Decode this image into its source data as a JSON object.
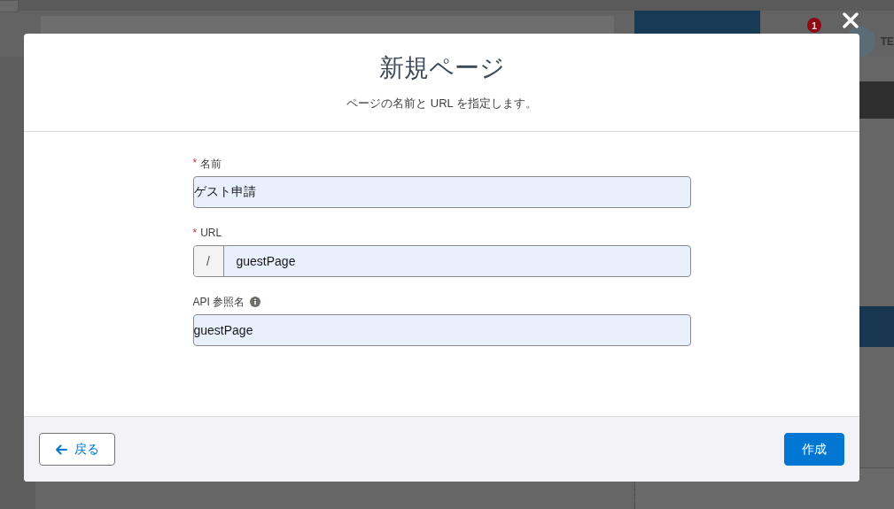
{
  "background": {
    "notification_count": "1",
    "user_name": "TE"
  },
  "modal": {
    "title": "新規ページ",
    "subtitle": "ページの名前と URL を指定します。",
    "fields": [
      {
        "kind": "text",
        "label": "名前",
        "required_mark": "*",
        "info": false,
        "value": "ゲスト申請"
      },
      {
        "kind": "prefixed",
        "label": "URL",
        "required_mark": "*",
        "info": false,
        "prefix": "/",
        "value": "guestPage"
      },
      {
        "kind": "text",
        "label": "API 参照名",
        "info": true,
        "value": "guestPage"
      }
    ],
    "buttons": [
      {
        "kind": "neutral",
        "label": "戻る"
      },
      {
        "kind": "brand",
        "label": "作成"
      }
    ]
  }
}
